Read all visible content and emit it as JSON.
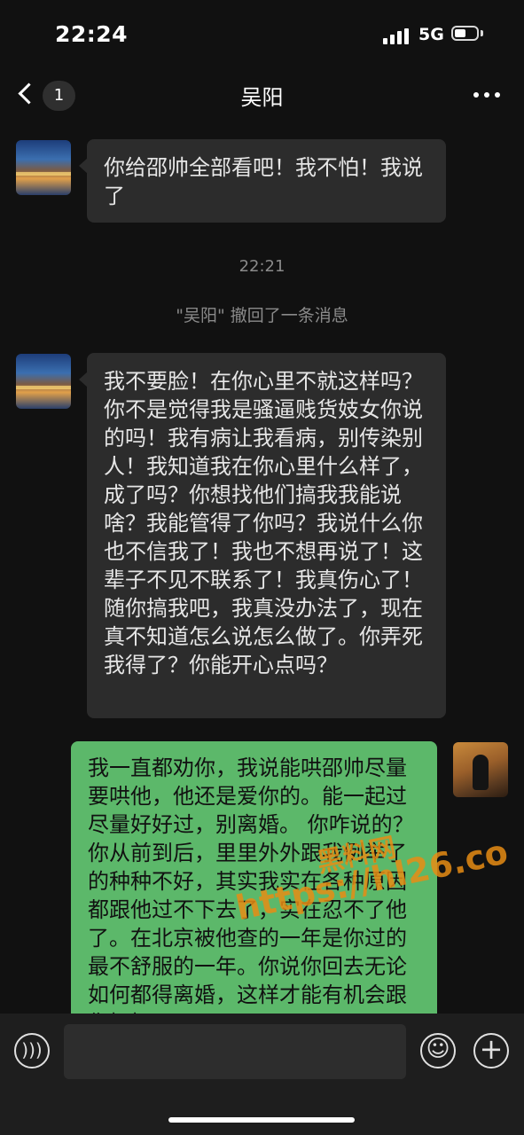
{
  "status_bar": {
    "time": "22:24",
    "network": "5G",
    "signal_icon": "signal-bars-icon",
    "battery_icon": "battery-icon",
    "battery_level": 0.5
  },
  "nav": {
    "back_icon": "chevron-left-icon",
    "unread_count": "1",
    "title": "吴阳",
    "more_icon": "more-dots-icon"
  },
  "messages": [
    {
      "direction": "incoming",
      "avatar": "city-night-photo-avatar",
      "text": "你给邵帅全部看吧！我不怕！我说了"
    },
    {
      "direction": "incoming",
      "avatar": "city-night-photo-avatar",
      "text": "我不要脸！在你心里不就这样吗？你不是觉得我是骚逼贱货妓女你说的吗！我有病让我看病，别传染别人！我知道我在你心里什么样了，成了吗？你想找他们搞我我能说啥？我能管得了你吗？我说什么你也不信我了！我也不想再说了！这辈子不见不联系了！我真伤心了！随你搞我吧，我真没办法了，现在真不知道怎么说怎么做了。你弄死我得了？你能开心点吗？"
    },
    {
      "direction": "outgoing",
      "avatar": "autumn-portrait-avatar",
      "text": "我一直都劝你，我说能哄邵帅尽量要哄他，他还是爱你的。能一起过尽量好好过，别离婚。 你咋说的？你从前到后，里里外外跟我例举了的种种不好，其实我实在各种原因都跟他过不下去了，实在忍不了他了。在北京被他查的一年是你过的最不舒服的一年。你说你回去无论如何都得离婚，这样才能有机会跟你好好"
    }
  ],
  "system": {
    "timestamp": "22:21",
    "recall_notice": "\"吴阳\" 撤回了一条消息"
  },
  "watermark": {
    "name": "黑料网",
    "url": "https://hl26.co"
  },
  "input_bar": {
    "voice_icon": "voice-icon",
    "emoji_icon": "emoji-icon",
    "plus_icon": "plus-icon"
  }
}
